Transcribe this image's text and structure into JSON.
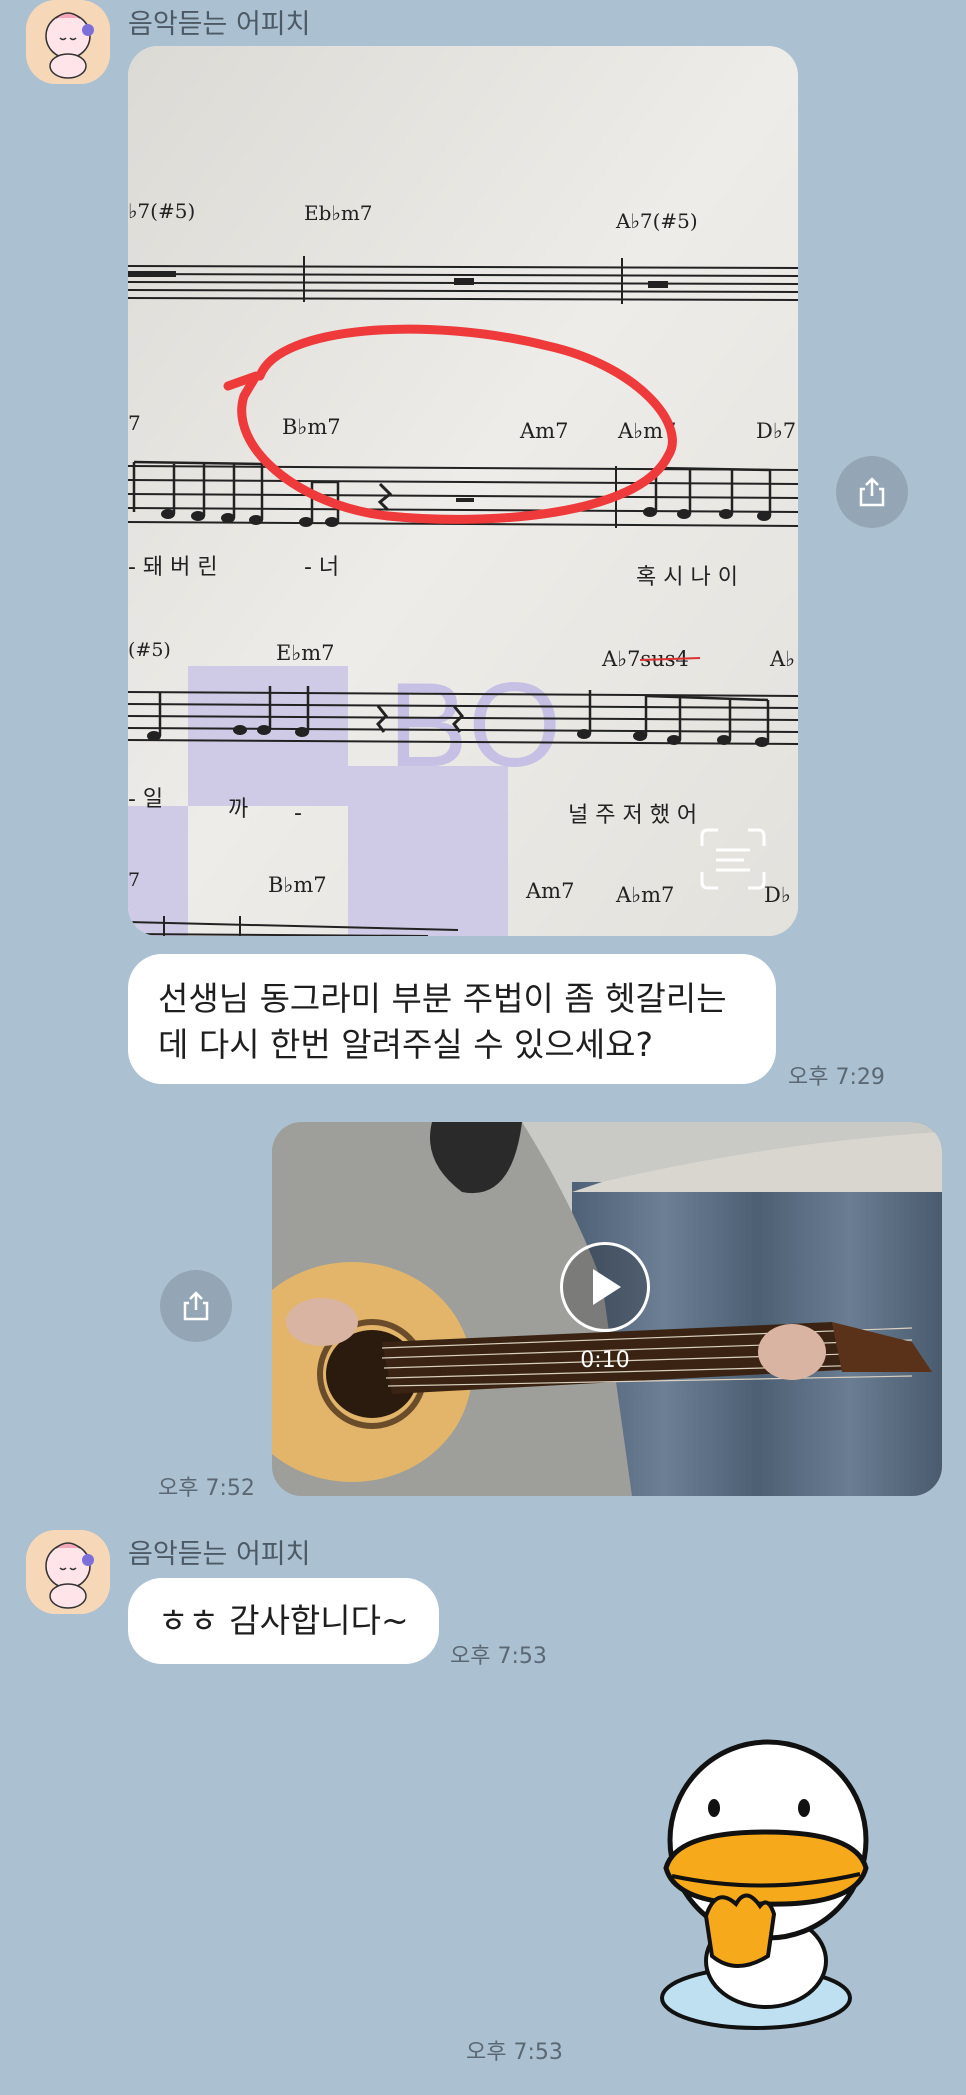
{
  "chat": {
    "sender_name": "음악듣는 어피치",
    "messages": {
      "m1_text": "선생님 동그라미 부분 주법이 좀 헷갈리는데 다시 한번 알려주실 수 있으세요?",
      "m1_time": "오후 7:29",
      "video_duration": "0:10",
      "video_time": "오후 7:52",
      "m3_text": "ㅎㅎ 감사합니다~",
      "m3_time": "오후 7:53",
      "sticker_time": "오후 7:53"
    },
    "sheet": {
      "chords_row1": [
        "♭7(#5)",
        "Eb♭m7",
        "A♭7(#5)"
      ],
      "chords_row2": [
        "7",
        "B♭m7",
        "Am7",
        "A♭m7",
        "D♭7"
      ],
      "chords_row3": [
        "(#5)",
        "E♭m7",
        "A♭7sus4",
        "A♭"
      ],
      "chords_row4": [
        "7",
        "B♭m7",
        "Am7",
        "A♭m7",
        "D♭"
      ],
      "lyrics_row1": [
        "- 돼 버 린",
        "- 너",
        "혹 시 나 이"
      ],
      "lyrics_row2": [
        "- 일",
        "까",
        "-",
        "널 주 저 했 어"
      ]
    }
  }
}
